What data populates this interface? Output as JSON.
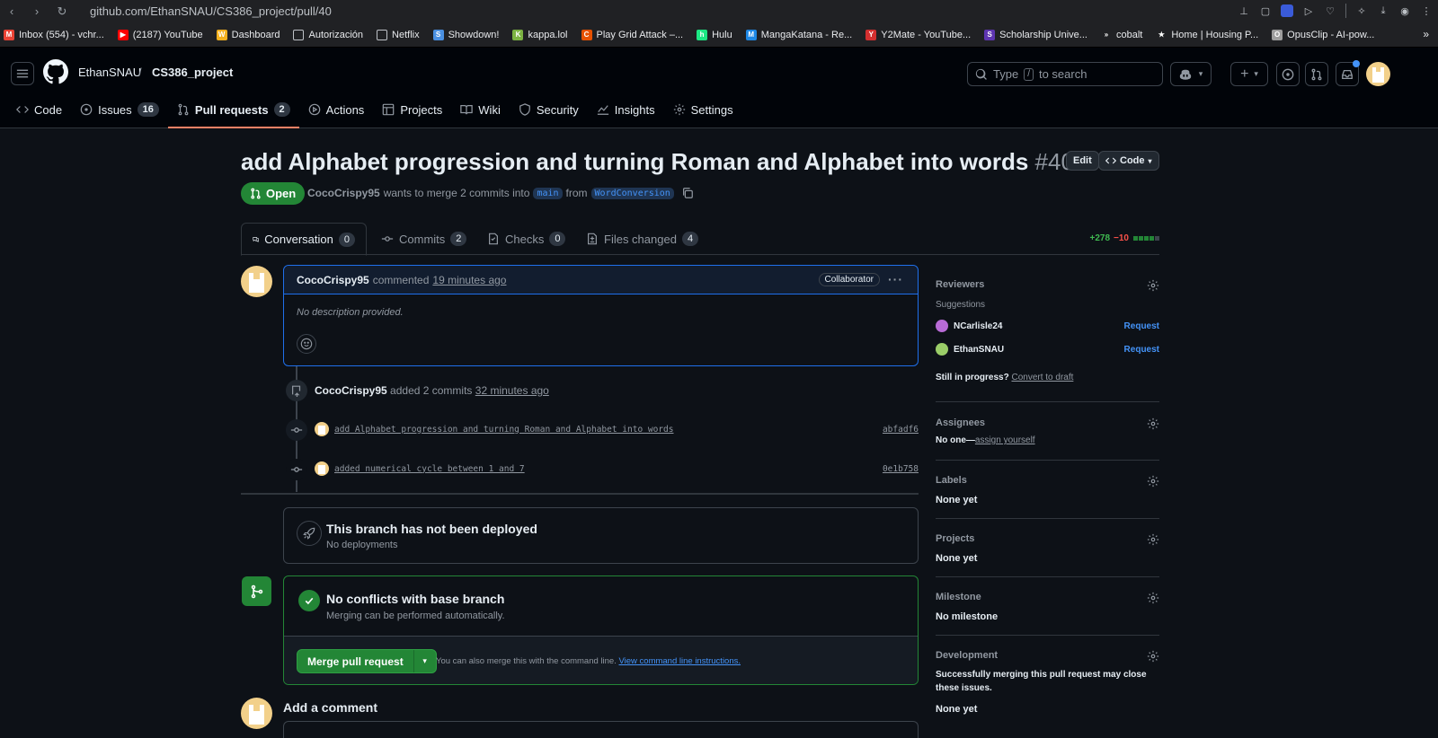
{
  "browser": {
    "url": "github.com/EthanSNAU/CS386_project/pull/40",
    "bookmarks": [
      {
        "label": "Inbox (554) - vchr...",
        "color": "#ea4335",
        "glyph": "M"
      },
      {
        "label": "(2187) YouTube",
        "color": "#ff0000",
        "glyph": "▶"
      },
      {
        "label": "Dashboard",
        "color": "#f2b01e",
        "glyph": "W"
      },
      {
        "label": "Autorización",
        "color": "#5f6368",
        "glyph": ""
      },
      {
        "label": "Netflix",
        "color": "#5f6368",
        "glyph": ""
      },
      {
        "label": "Showdown!",
        "color": "#4a90e2",
        "glyph": "S"
      },
      {
        "label": "kappa.lol",
        "color": "#7cb342",
        "glyph": "K"
      },
      {
        "label": "Play Grid Attack –...",
        "color": "#e65100",
        "glyph": "C"
      },
      {
        "label": "Hulu",
        "color": "#1ce783",
        "glyph": "h"
      },
      {
        "label": "MangaKatana - Re...",
        "color": "#1e88e5",
        "glyph": "M"
      },
      {
        "label": "Y2Mate - YouTube...",
        "color": "#d32f2f",
        "glyph": "Y"
      },
      {
        "label": "Scholarship Unive...",
        "color": "#5e35b1",
        "glyph": "S"
      },
      {
        "label": "cobalt",
        "color": "#202124",
        "glyph": "»"
      },
      {
        "label": "Home | Housing P...",
        "color": "#202124",
        "glyph": "★"
      },
      {
        "label": "OpusClip - AI-pow...",
        "color": "#9e9e9e",
        "glyph": "O"
      }
    ]
  },
  "header": {
    "owner": "EthanSNAU",
    "repo": "CS386_project",
    "search_before": "Type",
    "search_key": "/",
    "search_after": "to search"
  },
  "repo_tabs": [
    {
      "label": "Code",
      "count": ""
    },
    {
      "label": "Issues",
      "count": "16"
    },
    {
      "label": "Pull requests",
      "count": "2"
    },
    {
      "label": "Actions",
      "count": ""
    },
    {
      "label": "Projects",
      "count": ""
    },
    {
      "label": "Wiki",
      "count": ""
    },
    {
      "label": "Security",
      "count": ""
    },
    {
      "label": "Insights",
      "count": ""
    },
    {
      "label": "Settings",
      "count": ""
    }
  ],
  "pr": {
    "title": "add Alphabet progression and turning Roman and Alphabet into words",
    "number": "#40",
    "edit_label": "Edit",
    "code_label": "Code",
    "state": "Open",
    "author": "CocoCrispy95",
    "meta_mid": "wants to merge 2 commits into",
    "base": "main",
    "from_word": "from",
    "head": "WordConversion"
  },
  "pr_tabs": [
    {
      "label": "Conversation",
      "count": "0"
    },
    {
      "label": "Commits",
      "count": "2"
    },
    {
      "label": "Checks",
      "count": "0"
    },
    {
      "label": "Files changed",
      "count": "4"
    }
  ],
  "diffstat": {
    "additions": "+278",
    "deletions": "−10",
    "green_blocks": 4,
    "total_blocks": 5
  },
  "comment": {
    "author": "CocoCrispy95",
    "action": "commented",
    "time": "19 minutes ago",
    "role": "Collaborator",
    "body": "No description provided."
  },
  "commits_event": {
    "author": "CocoCrispy95",
    "action": "added 2 commits",
    "time": "32 minutes ago"
  },
  "commits": [
    {
      "message": "add Alphabet progression and turning Roman and Alphabet into words",
      "sha": "abfadf6"
    },
    {
      "message": "added numerical cycle between 1 and 7",
      "sha": "0e1b758"
    }
  ],
  "deploy": {
    "title": "This branch has not been deployed",
    "sub": "No deployments"
  },
  "merge": {
    "title": "No conflicts with base branch",
    "sub": "Merging can be performed automatically.",
    "button": "Merge pull request",
    "note": "You can also merge this with the command line.",
    "note_link": "View command line instructions."
  },
  "add_comment": "Add a comment",
  "sidebar": {
    "reviewers": {
      "title": "Reviewers",
      "suggestions": "Suggestions",
      "people": [
        {
          "name": "NCarlisle24",
          "action": "Request",
          "color": "#b86bd6"
        },
        {
          "name": "EthanSNAU",
          "action": "Request",
          "color": "#9acd68"
        }
      ],
      "in_progress": "Still in progress?",
      "convert": "Convert to draft"
    },
    "assignees": {
      "title": "Assignees",
      "value": "No one—",
      "link": "assign yourself"
    },
    "labels": {
      "title": "Labels",
      "value": "None yet"
    },
    "projects": {
      "title": "Projects",
      "value": "None yet"
    },
    "milestone": {
      "title": "Milestone",
      "value": "No milestone"
    },
    "development": {
      "title": "Development",
      "value": "Successfully merging this pull request may close these issues.",
      "value2": "None yet"
    }
  }
}
